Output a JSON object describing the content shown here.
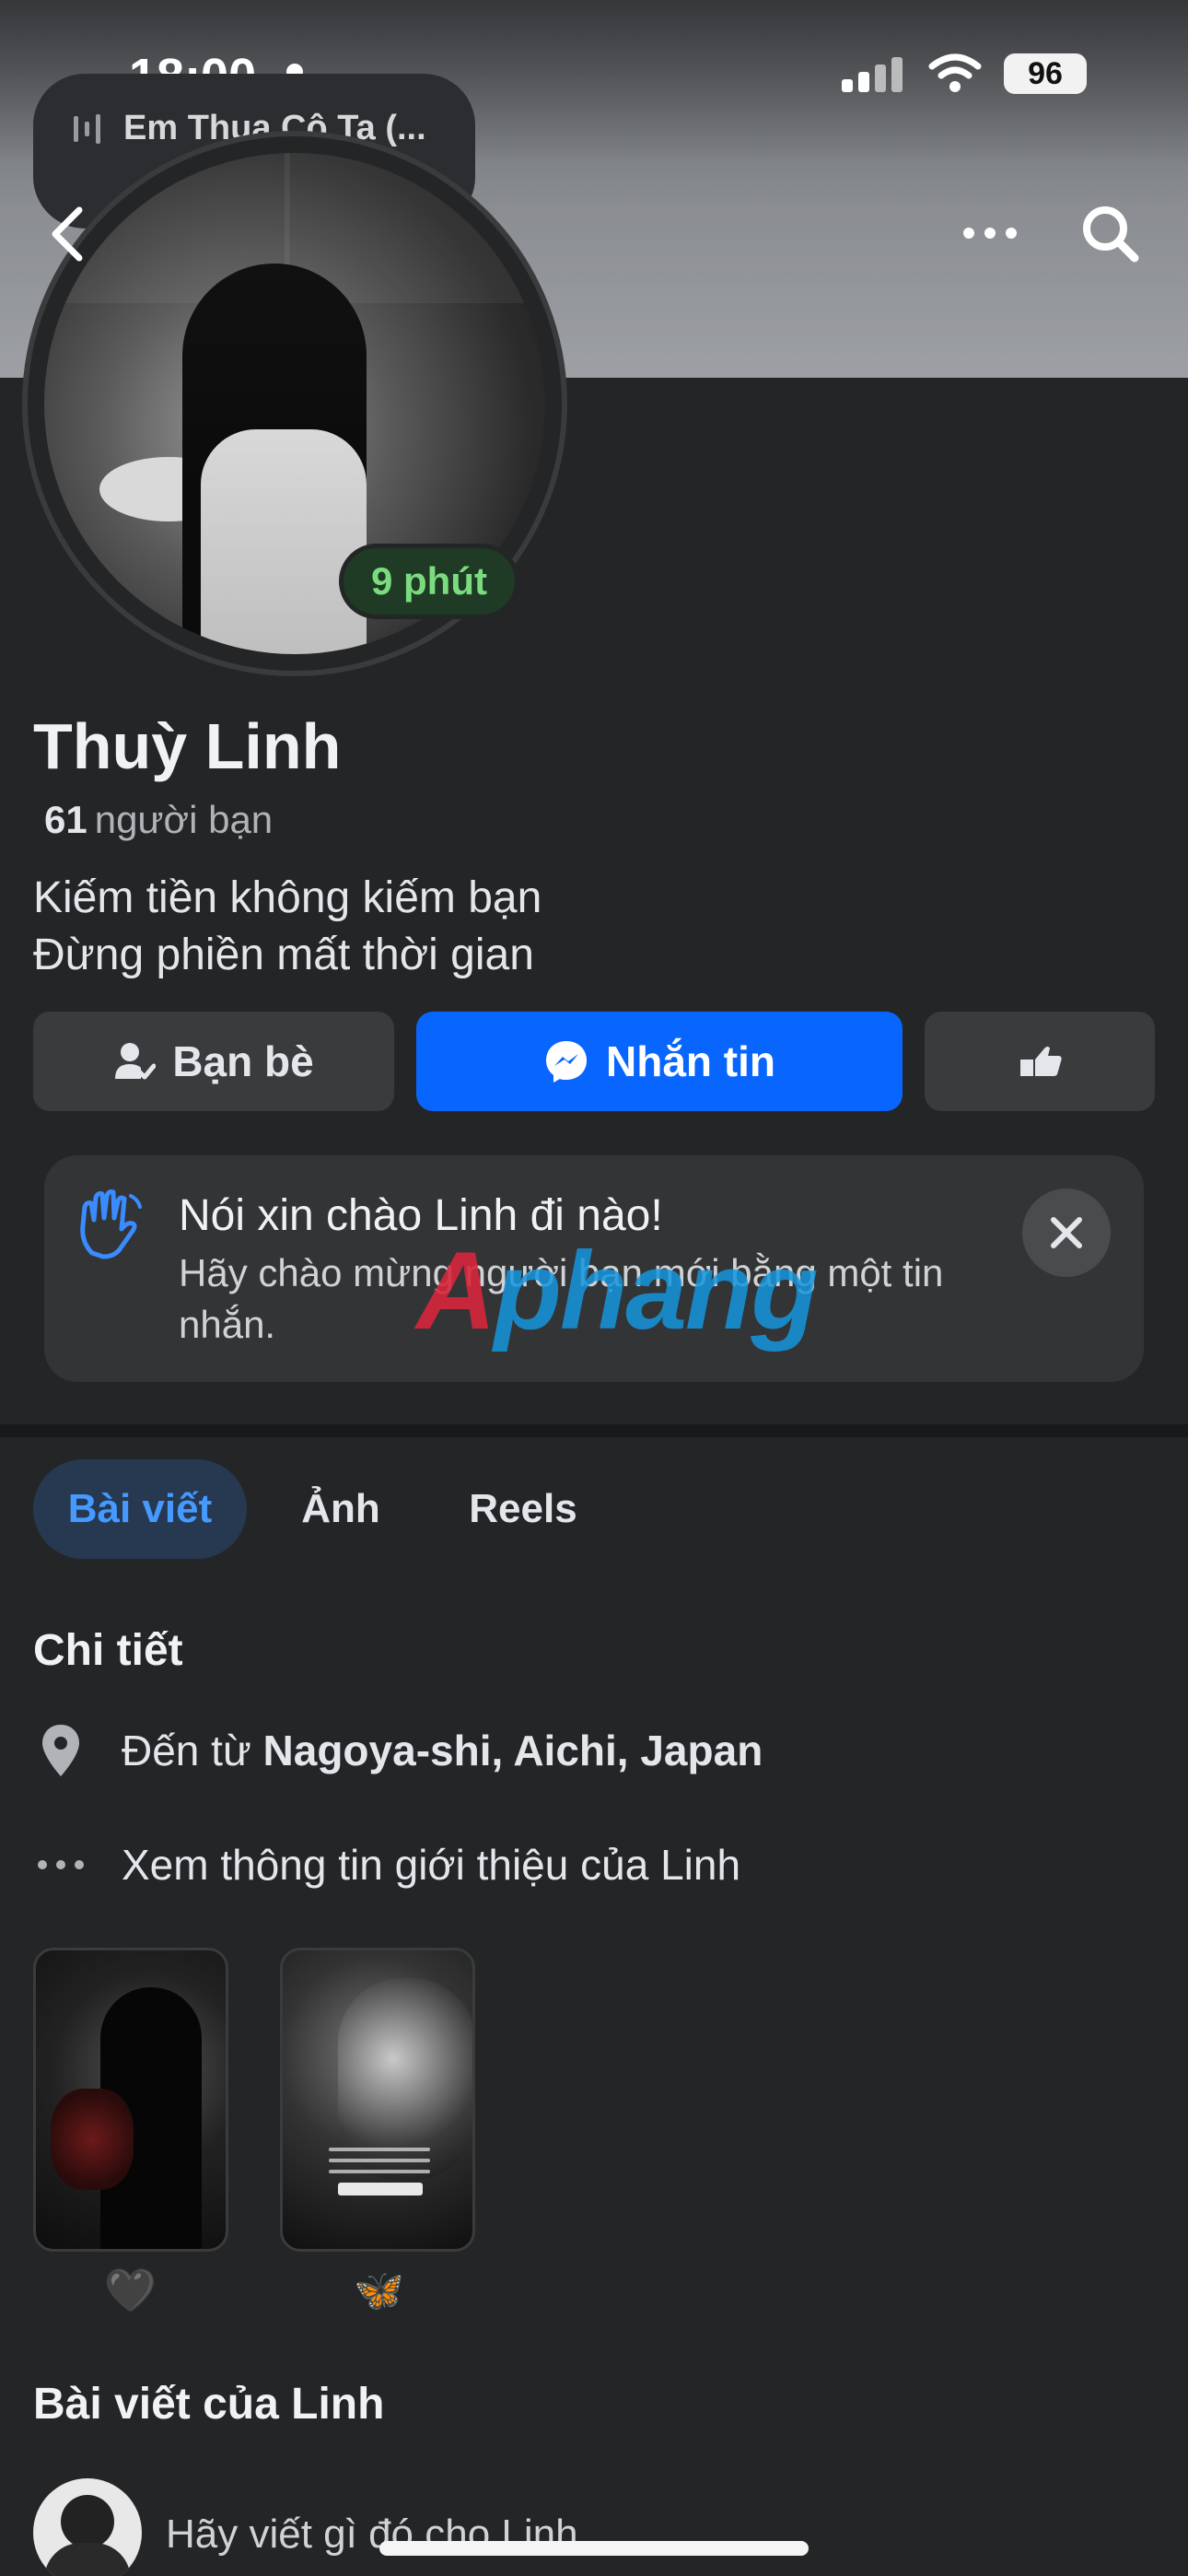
{
  "status_bar": {
    "time": "18:00",
    "battery": "96"
  },
  "now_playing": {
    "title": "Em Thua Cô Ta (...",
    "emoji": "❤️‍🩹"
  },
  "profile": {
    "active_badge": "9 phút",
    "name": "Thuỳ Linh",
    "friends_count": "61",
    "friends_label": "người bạn",
    "bio_line_1": "Kiếm tiền không kiếm bạn",
    "bio_line_2": "Đừng phiền mất thời gian"
  },
  "actions": {
    "friends_label": "Bạn bè",
    "message_label": "Nhắn tin"
  },
  "greet_card": {
    "title": "Nói xin chào Linh đi nào!",
    "subtitle": "Hãy chào mừng người bạn mới bằng một tin nhắn."
  },
  "watermark": {
    "part1": "A",
    "part2": "phang"
  },
  "tabs": [
    {
      "label": "Bài viết",
      "active": true
    },
    {
      "label": "Ảnh",
      "active": false
    },
    {
      "label": "Reels",
      "active": false
    }
  ],
  "details": {
    "title": "Chi tiết",
    "location_prefix": "Đến từ",
    "location": "Nagoya-shi, Aichi, Japan",
    "about_link": "Xem thông tin giới thiệu của Linh"
  },
  "featured": [
    {
      "emoji": "🖤"
    },
    {
      "emoji": "🦋"
    }
  ],
  "posts": {
    "title": "Bài viết của Linh",
    "composer_placeholder": "Hãy viết gì đó cho Linh..."
  },
  "colors": {
    "accent": "#0866ff",
    "active_green": "#7bdc7f",
    "background": "#242526"
  },
  "icons": [
    "back-icon",
    "more-icon",
    "search-icon",
    "friend-check-icon",
    "messenger-icon",
    "poke-icon",
    "wave-icon",
    "close-icon",
    "location-icon",
    "ellipsis-icon"
  ]
}
